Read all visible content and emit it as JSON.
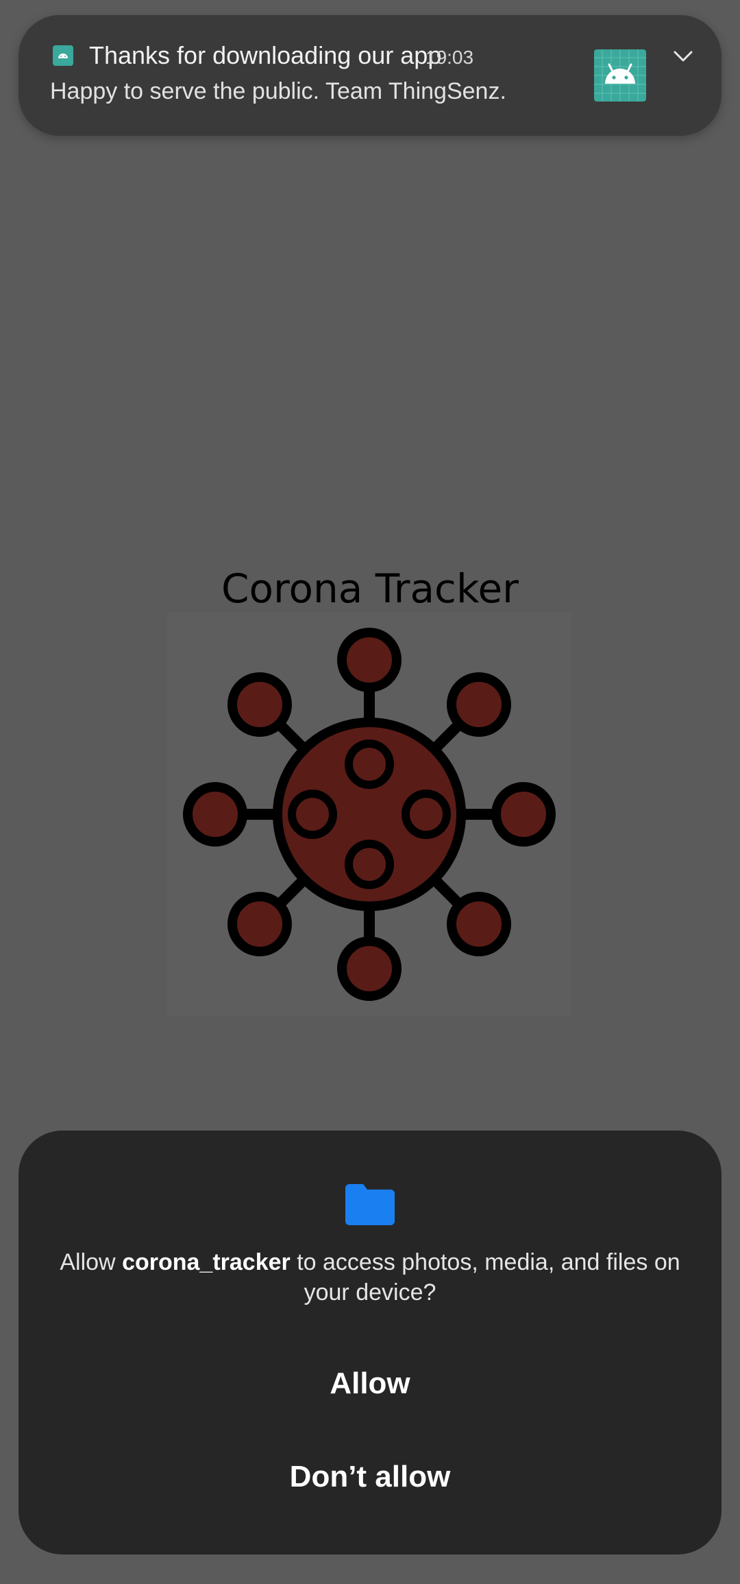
{
  "notification": {
    "title": "Thanks for downloading our app",
    "time": "19:03",
    "body": "Happy to serve the public. Team ThingSenz.",
    "app_icon": "android-icon",
    "expand_icon": "chevron-down-icon",
    "accent_color": "#3aa89a"
  },
  "app": {
    "title": "Corona Tracker",
    "image": "coronavirus-icon",
    "virus_color": "#5a1c17"
  },
  "permission_dialog": {
    "icon": "folder-icon",
    "icon_color": "#1a7ff0",
    "message_prefix": "Allow ",
    "app_name": "corona_tracker",
    "message_suffix": " to access photos, media, and files on your device?",
    "allow_label": "Allow",
    "deny_label": "Don’t allow"
  }
}
